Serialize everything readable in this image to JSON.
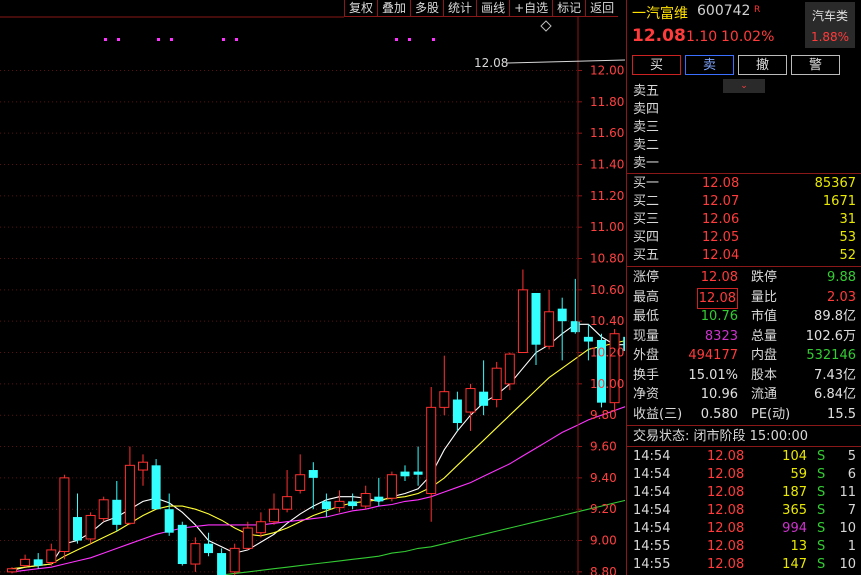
{
  "toolbar": [
    "复权",
    "叠加",
    "多股",
    "统计",
    "画线",
    "+自选",
    "标记",
    "返回"
  ],
  "chart_data": {
    "type": "candlestick",
    "y_ticks": [
      "12.00",
      "11.80",
      "11.60",
      "11.40",
      "11.20",
      "11.00",
      "10.80",
      "10.60",
      "10.40",
      "10.20",
      "10.00",
      "9.80",
      "9.60",
      "9.40",
      "9.20",
      "9.00",
      "8.80"
    ],
    "ylim": [
      8.78,
      12.45
    ],
    "last_price_label": "12.08",
    "candles": [
      {
        "o": 8.8,
        "c": 8.82,
        "h": 8.83,
        "l": 8.79
      },
      {
        "o": 8.84,
        "c": 8.88,
        "h": 8.91,
        "l": 8.83
      },
      {
        "o": 8.88,
        "c": 8.84,
        "h": 8.92,
        "l": 8.82
      },
      {
        "o": 8.86,
        "c": 8.94,
        "h": 8.98,
        "l": 8.84
      },
      {
        "o": 8.93,
        "c": 9.4,
        "h": 9.42,
        "l": 8.88
      },
      {
        "o": 9.15,
        "c": 9.0,
        "h": 9.3,
        "l": 8.98
      },
      {
        "o": 9.01,
        "c": 9.16,
        "h": 9.18,
        "l": 8.98
      },
      {
        "o": 9.14,
        "c": 9.26,
        "h": 9.28,
        "l": 9.12
      },
      {
        "o": 9.26,
        "c": 9.1,
        "h": 9.38,
        "l": 9.06
      },
      {
        "o": 9.11,
        "c": 9.48,
        "h": 9.6,
        "l": 9.1
      },
      {
        "o": 9.45,
        "c": 9.5,
        "h": 9.55,
        "l": 9.35
      },
      {
        "o": 9.48,
        "c": 9.2,
        "h": 9.52,
        "l": 9.2
      },
      {
        "o": 9.2,
        "c": 9.05,
        "h": 9.3,
        "l": 9.03
      },
      {
        "o": 9.1,
        "c": 8.85,
        "h": 9.12,
        "l": 8.84
      },
      {
        "o": 8.85,
        "c": 8.98,
        "h": 9.02,
        "l": 8.8
      },
      {
        "o": 8.98,
        "c": 8.92,
        "h": 9.05,
        "l": 8.9
      },
      {
        "o": 8.92,
        "c": 8.78,
        "h": 8.95,
        "l": 8.76
      },
      {
        "o": 8.8,
        "c": 8.95,
        "h": 8.98,
        "l": 8.78
      },
      {
        "o": 8.95,
        "c": 9.08,
        "h": 9.12,
        "l": 8.94
      },
      {
        "o": 9.05,
        "c": 9.12,
        "h": 9.18,
        "l": 9.02
      },
      {
        "o": 9.12,
        "c": 9.2,
        "h": 9.3,
        "l": 9.1
      },
      {
        "o": 9.2,
        "c": 9.28,
        "h": 9.45,
        "l": 9.18
      },
      {
        "o": 9.32,
        "c": 9.42,
        "h": 9.55,
        "l": 9.3
      },
      {
        "o": 9.45,
        "c": 9.4,
        "h": 9.5,
        "l": 9.2
      },
      {
        "o": 9.25,
        "c": 9.2,
        "h": 9.3,
        "l": 9.15
      },
      {
        "o": 9.21,
        "c": 9.25,
        "h": 9.32,
        "l": 9.18
      },
      {
        "o": 9.25,
        "c": 9.22,
        "h": 9.3,
        "l": 9.2
      },
      {
        "o": 9.22,
        "c": 9.3,
        "h": 9.35,
        "l": 9.2
      },
      {
        "o": 9.28,
        "c": 9.25,
        "h": 9.4,
        "l": 9.22
      },
      {
        "o": 9.27,
        "c": 9.42,
        "h": 9.44,
        "l": 9.25
      },
      {
        "o": 9.44,
        "c": 9.41,
        "h": 9.48,
        "l": 9.38
      },
      {
        "o": 9.44,
        "c": 9.42,
        "h": 9.6,
        "l": 9.35
      },
      {
        "o": 9.3,
        "c": 9.85,
        "h": 9.98,
        "l": 9.12
      },
      {
        "o": 9.85,
        "c": 9.95,
        "h": 10.18,
        "l": 9.8
      },
      {
        "o": 9.9,
        "c": 9.75,
        "h": 9.95,
        "l": 9.7
      },
      {
        "o": 9.82,
        "c": 9.97,
        "h": 10.0,
        "l": 9.7
      },
      {
        "o": 9.95,
        "c": 9.86,
        "h": 10.15,
        "l": 9.8
      },
      {
        "o": 9.9,
        "c": 10.1,
        "h": 10.14,
        "l": 9.85
      },
      {
        "o": 10.0,
        "c": 10.19,
        "h": 10.2,
        "l": 9.96
      },
      {
        "o": 10.2,
        "c": 10.6,
        "h": 10.73,
        "l": 10.2
      },
      {
        "o": 10.58,
        "c": 10.25,
        "h": 10.58,
        "l": 10.12
      },
      {
        "o": 10.24,
        "c": 10.46,
        "h": 10.6,
        "l": 10.22
      },
      {
        "o": 10.48,
        "c": 10.4,
        "h": 10.55,
        "l": 10.15
      },
      {
        "o": 10.4,
        "c": 10.33,
        "h": 10.67,
        "l": 10.32
      },
      {
        "o": 10.3,
        "c": 10.27,
        "h": 10.38,
        "l": 10.15
      },
      {
        "o": 10.28,
        "c": 9.88,
        "h": 10.32,
        "l": 9.85
      },
      {
        "o": 9.88,
        "c": 10.32,
        "h": 10.35,
        "l": 9.82
      },
      {
        "o": 10.3,
        "c": 10.21,
        "h": 10.5,
        "l": 10.18
      },
      {
        "o": 10.22,
        "c": 10.4,
        "h": 10.6,
        "l": 10.2
      },
      {
        "o": 10.4,
        "c": 11.0,
        "h": 11.33,
        "l": 10.4
      },
      {
        "o": 10.8,
        "c": 12.08,
        "h": 12.08,
        "l": 10.76
      }
    ],
    "ma": [
      {
        "color": "#ffffff",
        "values": [
          8.81,
          8.83,
          8.84,
          8.85,
          8.98,
          9.0,
          9.05,
          9.12,
          9.15,
          9.2,
          9.25,
          9.27,
          9.24,
          9.18,
          9.1,
          9.0,
          8.96,
          8.92,
          8.94,
          8.99,
          9.04,
          9.11,
          9.17,
          9.22,
          9.26,
          9.28,
          9.28,
          9.27,
          9.25,
          9.28,
          9.3,
          9.33,
          9.42,
          9.58,
          9.7,
          9.8,
          9.88,
          9.93,
          10.0,
          10.1,
          10.2,
          10.25,
          10.32,
          10.38,
          10.38,
          10.3,
          10.25,
          10.25,
          10.26,
          10.4,
          10.68
        ]
      },
      {
        "color": "#ffff33",
        "values": [
          8.82,
          8.83,
          8.84,
          8.85,
          8.9,
          8.94,
          8.98,
          9.02,
          9.06,
          9.11,
          9.16,
          9.2,
          9.22,
          9.22,
          9.2,
          9.17,
          9.13,
          9.08,
          9.04,
          9.03,
          9.05,
          9.08,
          9.12,
          9.16,
          9.19,
          9.22,
          9.24,
          9.25,
          9.26,
          9.27,
          9.28,
          9.3,
          9.34,
          9.4,
          9.48,
          9.56,
          9.64,
          9.72,
          9.8,
          9.88,
          9.96,
          10.04,
          10.1,
          10.16,
          10.22,
          10.24,
          10.26,
          10.28,
          10.3,
          10.38,
          10.52
        ]
      },
      {
        "color": "#ff33ff",
        "values": [
          8.8,
          8.81,
          8.82,
          8.83,
          8.85,
          8.87,
          8.89,
          8.92,
          8.95,
          8.98,
          9.01,
          9.04,
          9.06,
          9.08,
          9.09,
          9.1,
          9.1,
          9.1,
          9.1,
          9.1,
          9.11,
          9.12,
          9.13,
          9.14,
          9.15,
          9.17,
          9.19,
          9.2,
          9.22,
          9.23,
          9.25,
          9.26,
          9.28,
          9.31,
          9.34,
          9.37,
          9.41,
          9.45,
          9.49,
          9.54,
          9.59,
          9.64,
          9.69,
          9.73,
          9.77,
          9.8,
          9.83,
          9.86,
          9.9,
          9.96,
          10.05
        ]
      },
      {
        "color": "#33cc33",
        "values": [
          null,
          null,
          null,
          null,
          null,
          null,
          null,
          null,
          null,
          null,
          null,
          null,
          null,
          null,
          null,
          null,
          8.78,
          8.79,
          8.8,
          8.81,
          8.82,
          8.83,
          8.84,
          8.85,
          8.86,
          8.87,
          8.88,
          8.89,
          8.9,
          8.92,
          8.93,
          8.95,
          8.96,
          8.98,
          9.0,
          9.02,
          9.04,
          9.06,
          9.08,
          9.1,
          9.12,
          9.14,
          9.16,
          9.18,
          9.2,
          9.22,
          9.24,
          9.26,
          9.28,
          9.3,
          9.32
        ]
      }
    ]
  },
  "header": {
    "name": "一汽富维",
    "code": "600742",
    "tag": "R",
    "sector_name": "汽车类",
    "sector_pct": "1.88%",
    "price": "12.08",
    "change": "1.10",
    "change_pct": "10.02%"
  },
  "buttons": [
    "买",
    "卖",
    "撤",
    "警"
  ],
  "asks": [
    {
      "label": "卖五",
      "price": "",
      "vol": ""
    },
    {
      "label": "卖四",
      "price": "",
      "vol": ""
    },
    {
      "label": "卖三",
      "price": "",
      "vol": ""
    },
    {
      "label": "卖二",
      "price": "",
      "vol": ""
    },
    {
      "label": "卖一",
      "price": "",
      "vol": ""
    }
  ],
  "bids": [
    {
      "label": "买一",
      "price": "12.08",
      "vol": "85367"
    },
    {
      "label": "买二",
      "price": "12.07",
      "vol": "1671"
    },
    {
      "label": "买三",
      "price": "12.06",
      "vol": "31"
    },
    {
      "label": "买四",
      "price": "12.05",
      "vol": "53"
    },
    {
      "label": "买五",
      "price": "12.04",
      "vol": "52"
    }
  ],
  "stats": [
    {
      "l1": "涨停",
      "v1": "12.08",
      "c1": "red",
      "l2": "跌停",
      "v2": "9.88",
      "c2": "green"
    },
    {
      "l1": "最高",
      "v1": "12.08",
      "c1": "red",
      "l2": "量比",
      "v2": "2.03",
      "c2": "red"
    },
    {
      "l1": "最低",
      "v1": "10.76",
      "c1": "green",
      "l2": "市值",
      "v2": "89.8亿",
      "c2": "white"
    },
    {
      "l1": "现量",
      "v1": "8323",
      "c1": "purple",
      "l2": "总量",
      "v2": "102.6万",
      "c2": "white"
    },
    {
      "l1": "外盘",
      "v1": "494177",
      "c1": "red",
      "l2": "内盘",
      "v2": "532146",
      "c2": "green"
    },
    {
      "l1": "换手",
      "v1": "15.01%",
      "c1": "white",
      "l2": "股本",
      "v2": "7.43亿",
      "c2": "white"
    },
    {
      "l1": "净资",
      "v1": "10.96",
      "c1": "white",
      "l2": "流通",
      "v2": "6.84亿",
      "c2": "white"
    },
    {
      "l1": "收益(三)",
      "v1": "0.580",
      "c1": "white",
      "l2": "PE(动)",
      "v2": "15.5",
      "c2": "white"
    }
  ],
  "trade_status": "交易状态: 闭市阶段 15:00:00",
  "ticks": [
    {
      "time": "14:54",
      "price": "12.08",
      "vol": "104",
      "vcolor": "yellow",
      "side": "S",
      "num": "5"
    },
    {
      "time": "14:54",
      "price": "12.08",
      "vol": "59",
      "vcolor": "yellow",
      "side": "S",
      "num": "6"
    },
    {
      "time": "14:54",
      "price": "12.08",
      "vol": "187",
      "vcolor": "yellow",
      "side": "S",
      "num": "11"
    },
    {
      "time": "14:54",
      "price": "12.08",
      "vol": "365",
      "vcolor": "yellow",
      "side": "S",
      "num": "7"
    },
    {
      "time": "14:54",
      "price": "12.08",
      "vol": "994",
      "vcolor": "purple",
      "side": "S",
      "num": "10"
    },
    {
      "time": "14:55",
      "price": "12.08",
      "vol": "13",
      "vcolor": "yellow",
      "side": "S",
      "num": "1"
    },
    {
      "time": "14:55",
      "price": "12.08",
      "vol": "147",
      "vcolor": "yellow",
      "side": "S",
      "num": "10"
    }
  ]
}
